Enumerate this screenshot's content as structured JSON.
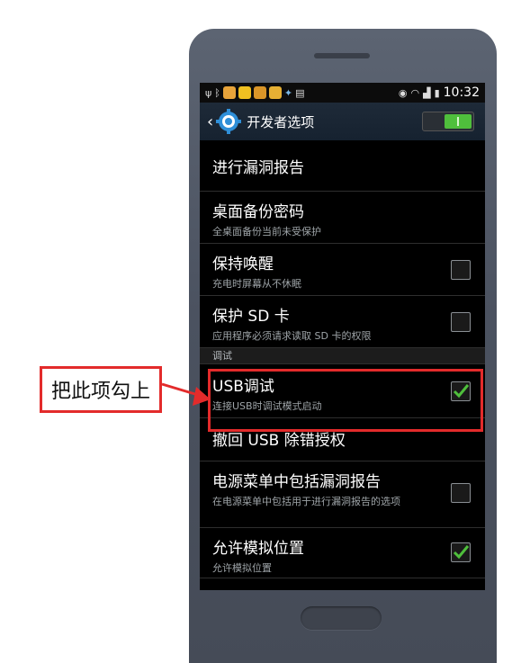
{
  "status_bar": {
    "time": "10:32",
    "icons": [
      "usb-icon",
      "bluetooth-icon",
      "app-icon-1",
      "app-icon-2",
      "app-icon-3",
      "app-icon-4",
      "notification-icon",
      "document-icon",
      "eye-icon",
      "wifi-icon",
      "signal-icon",
      "battery-icon"
    ]
  },
  "header": {
    "title": "开发者选项",
    "master_switch_on": true
  },
  "items": [
    {
      "title": "进行漏洞报告",
      "subtitle": ""
    },
    {
      "title": "桌面备份密码",
      "subtitle": "全桌面备份当前未受保护"
    },
    {
      "title": "保持唤醒",
      "subtitle": "充电时屏幕从不休眠",
      "checked": false
    },
    {
      "title": "保护 SD 卡",
      "subtitle": "应用程序必须请求读取 SD 卡的权限",
      "checked": false
    }
  ],
  "section_label": "调试",
  "debug_items": [
    {
      "title": "USB调试",
      "subtitle": "连接USB时调试模式启动",
      "checked": true
    },
    {
      "title": "撤回 USB 除错授权",
      "subtitle": ""
    },
    {
      "title": "电源菜单中包括漏洞报告",
      "subtitle": "在电源菜单中包括用于进行漏洞报告的选项",
      "checked": false
    },
    {
      "title": "允许模拟位置",
      "subtitle": "允许模拟位置",
      "checked": true
    }
  ],
  "annotation": {
    "callout_text": "把此项勾上"
  },
  "colors": {
    "accent_red": "#e32b2b",
    "check_green": "#4fbf3c"
  }
}
